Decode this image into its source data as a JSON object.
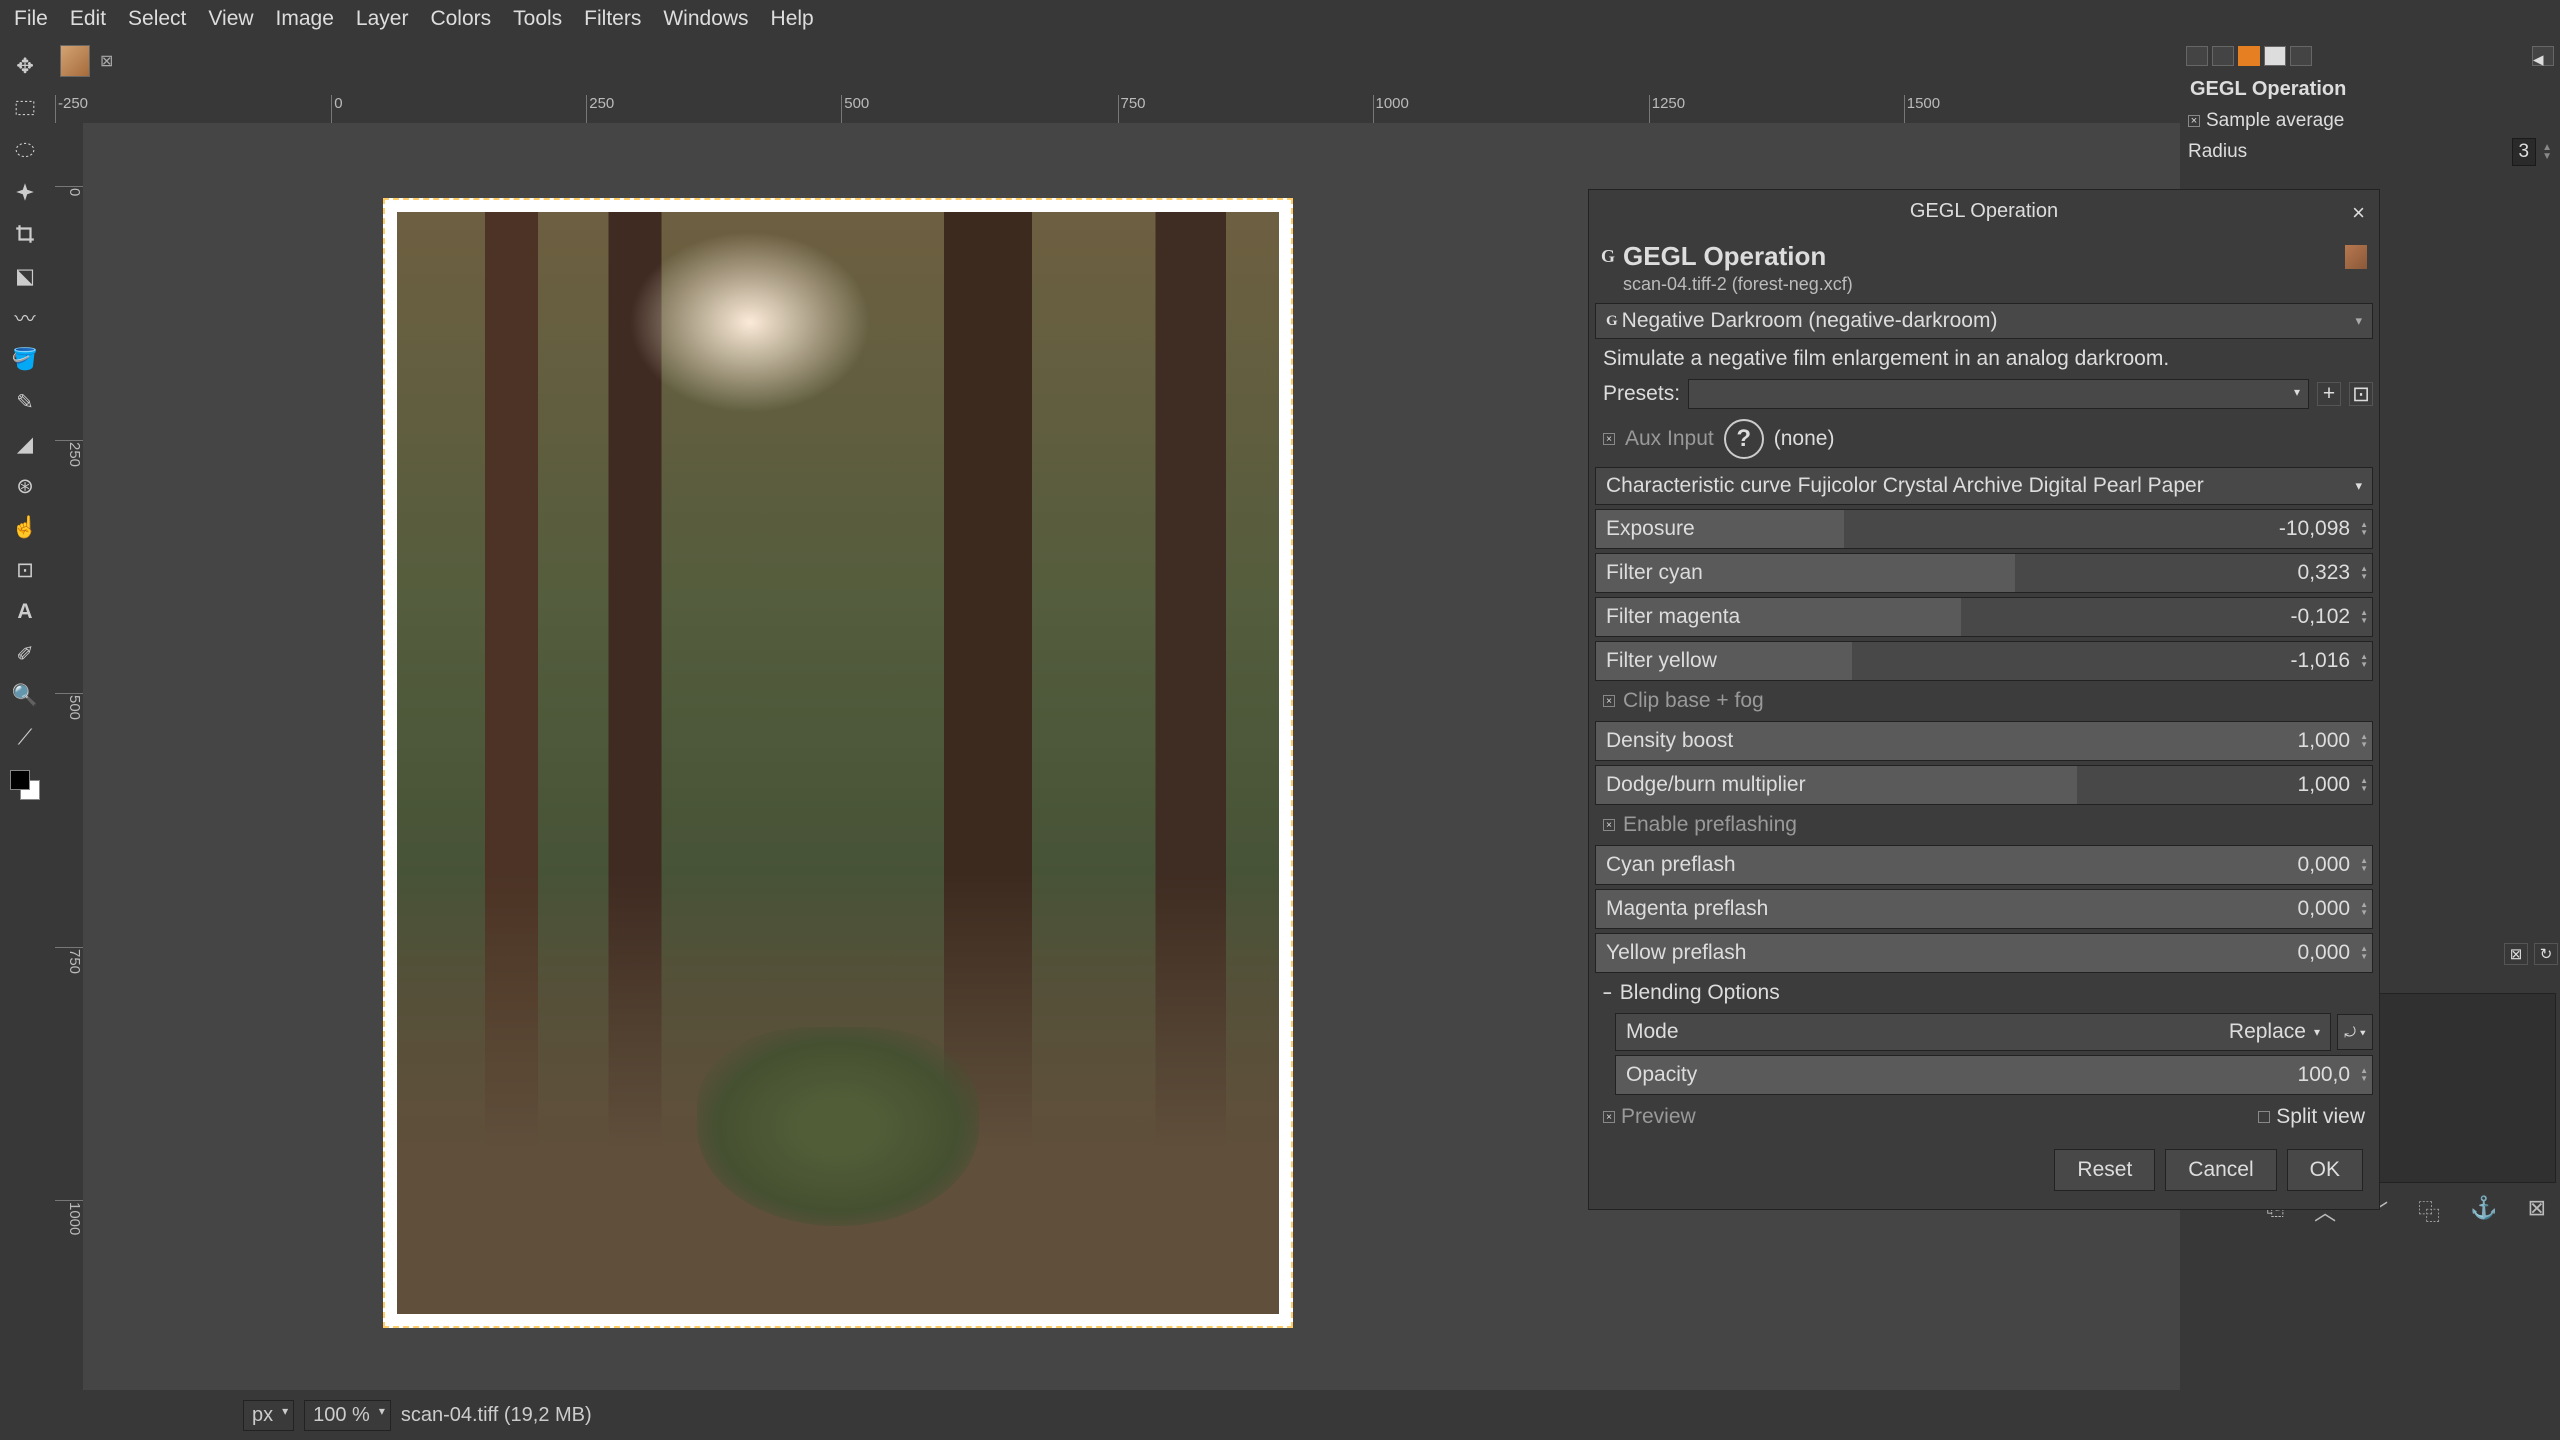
{
  "menu": [
    "File",
    "Edit",
    "Select",
    "View",
    "Image",
    "Layer",
    "Colors",
    "Tools",
    "Filters",
    "Windows",
    "Help"
  ],
  "ruler_h": [
    "-250",
    "0",
    "250",
    "500",
    "750",
    "1000",
    "1250",
    "1500"
  ],
  "ruler_v": [
    "0",
    "250",
    "500",
    "750",
    "1000"
  ],
  "status": {
    "unit": "px",
    "zoom": "100 %",
    "file": "scan-04.tiff (19,2 MB)"
  },
  "right_panel": {
    "title": "GEGL Operation",
    "sample_avg": "Sample average",
    "radius_lbl": "Radius",
    "radius_val": "3"
  },
  "dialog": {
    "title": "GEGL Operation",
    "header": "GEGL Operation",
    "sub": "scan-04.tiff-2 (forest-neg.xcf)",
    "operation": "Negative Darkroom (negative-darkroom)",
    "desc": "Simulate a negative film enlargement in an analog darkroom.",
    "presets_lbl": "Presets:",
    "aux_lbl": "Aux Input",
    "aux_val": "(none)",
    "curve_lbl": "Characteristic curve",
    "curve_val": "Fujicolor Crystal Archive Digital Pearl Paper",
    "sliders": {
      "exposure": {
        "label": "Exposure",
        "value": "-10,098",
        "fill": 32
      },
      "fcyan": {
        "label": "Filter cyan",
        "value": "0,323",
        "fill": 54
      },
      "fmag": {
        "label": "Filter magenta",
        "value": "-0,102",
        "fill": 47
      },
      "fyel": {
        "label": "Filter yellow",
        "value": "-1,016",
        "fill": 33
      },
      "density": {
        "label": "Density boost",
        "value": "1,000",
        "fill": 100
      },
      "dodge": {
        "label": "Dodge/burn multiplier",
        "value": "1,000",
        "fill": 62
      },
      "cpre": {
        "label": "Cyan preflash",
        "value": "0,000",
        "fill": 100
      },
      "mpre": {
        "label": "Magenta preflash",
        "value": "0,000",
        "fill": 100
      },
      "ypre": {
        "label": "Yellow preflash",
        "value": "0,000",
        "fill": 100
      },
      "opacity": {
        "label": "Opacity",
        "value": "100,0",
        "fill": 100
      }
    },
    "clip": "Clip base + fog",
    "preflash": "Enable preflashing",
    "blending": "Blending Options",
    "mode_lbl": "Mode",
    "mode_val": "Replace",
    "preview": "Preview",
    "split": "Split view",
    "btns": {
      "reset": "Reset",
      "cancel": "Cancel",
      "ok": "OK"
    }
  }
}
